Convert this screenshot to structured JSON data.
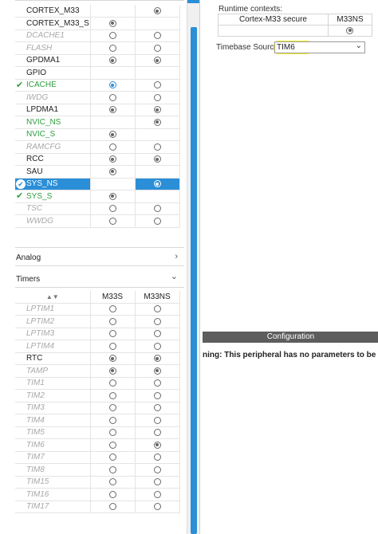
{
  "periph_rows": [
    {
      "name": "CORTEX_M33",
      "state": "normal",
      "check": "none",
      "c1": "none",
      "c2": "checked"
    },
    {
      "name": "CORTEX_M33_S",
      "state": "normal",
      "check": "none",
      "c1": "checked",
      "c2": "none"
    },
    {
      "name": "DCACHE1",
      "state": "disabled",
      "check": "none",
      "c1": "empty",
      "c2": "empty"
    },
    {
      "name": "FLASH",
      "state": "disabled",
      "check": "none",
      "c1": "empty",
      "c2": "empty"
    },
    {
      "name": "GPDMA1",
      "state": "normal",
      "check": "none",
      "c1": "checked",
      "c2": "checked"
    },
    {
      "name": "GPIO",
      "state": "normal",
      "check": "none",
      "c1": "none",
      "c2": "none"
    },
    {
      "name": "ICACHE",
      "state": "green",
      "check": "tick",
      "c1": "blue-checked",
      "c2": "empty"
    },
    {
      "name": "IWDG",
      "state": "disabled",
      "check": "none",
      "c1": "empty",
      "c2": "empty"
    },
    {
      "name": "LPDMA1",
      "state": "normal",
      "check": "none",
      "c1": "checked",
      "c2": "checked"
    },
    {
      "name": "NVIC_NS",
      "state": "green",
      "check": "none",
      "c1": "none",
      "c2": "checked"
    },
    {
      "name": "NVIC_S",
      "state": "green",
      "check": "none",
      "c1": "checked",
      "c2": "none"
    },
    {
      "name": "RAMCFG",
      "state": "disabled",
      "check": "none",
      "c1": "empty",
      "c2": "empty"
    },
    {
      "name": "RCC",
      "state": "normal",
      "check": "none",
      "c1": "checked",
      "c2": "checked"
    },
    {
      "name": "SAU",
      "state": "normal",
      "check": "none",
      "c1": "checked",
      "c2": "none"
    },
    {
      "name": "SYS_NS",
      "state": "selected",
      "check": "circle",
      "c1": "none",
      "c2": "sel"
    },
    {
      "name": "SYS_S",
      "state": "green",
      "check": "tick",
      "c1": "checked",
      "c2": "none"
    },
    {
      "name": "TSC",
      "state": "disabled",
      "check": "none",
      "c1": "empty",
      "c2": "empty"
    },
    {
      "name": "WWDG",
      "state": "disabled",
      "check": "none",
      "c1": "empty",
      "c2": "empty"
    }
  ],
  "analog_label": "Analog",
  "timers_label": "Timers",
  "timers_head": {
    "c1": "M33S",
    "c2": "M33NS"
  },
  "timer_rows": [
    {
      "name": "LPTIM1",
      "state": "disabled",
      "c1": "empty",
      "c2": "empty"
    },
    {
      "name": "LPTIM2",
      "state": "disabled",
      "c1": "empty",
      "c2": "empty"
    },
    {
      "name": "LPTIM3",
      "state": "disabled",
      "c1": "empty",
      "c2": "empty"
    },
    {
      "name": "LPTIM4",
      "state": "disabled",
      "c1": "empty",
      "c2": "empty"
    },
    {
      "name": "RTC",
      "state": "normal",
      "c1": "checked",
      "c2": "checked"
    },
    {
      "name": "TAMP",
      "state": "disabled",
      "c1": "checked",
      "c2": "checked"
    },
    {
      "name": "TIM1",
      "state": "disabled",
      "c1": "empty",
      "c2": "empty"
    },
    {
      "name": "TIM2",
      "state": "disabled",
      "c1": "empty",
      "c2": "empty"
    },
    {
      "name": "TIM3",
      "state": "disabled",
      "c1": "empty",
      "c2": "empty"
    },
    {
      "name": "TIM4",
      "state": "disabled",
      "c1": "empty",
      "c2": "empty"
    },
    {
      "name": "TIM5",
      "state": "disabled",
      "c1": "empty",
      "c2": "empty"
    },
    {
      "name": "TIM6",
      "state": "disabled",
      "c1": "empty",
      "c2": "checked"
    },
    {
      "name": "TIM7",
      "state": "disabled",
      "c1": "empty",
      "c2": "empty"
    },
    {
      "name": "TIM8",
      "state": "disabled",
      "c1": "empty",
      "c2": "empty"
    },
    {
      "name": "TIM15",
      "state": "disabled",
      "c1": "empty",
      "c2": "empty"
    },
    {
      "name": "TIM16",
      "state": "disabled",
      "c1": "empty",
      "c2": "empty"
    },
    {
      "name": "TIM17",
      "state": "disabled",
      "c1": "empty",
      "c2": "empty"
    }
  ],
  "runtime": {
    "title": "Runtime contexts:",
    "col1": "Cortex-M33 secure",
    "col2": "M33NS",
    "col1_value": "none",
    "col2_value": "checked"
  },
  "timebase": {
    "label": "Timebase Source",
    "value": "TIM6"
  },
  "configuration": {
    "header": "Configuration",
    "warning": "ning: This peripheral has no parameters to be co"
  },
  "colors": {
    "selection_blue": "#2b8fd8",
    "enabled_green": "#2e9e3f",
    "highlight_yellow": "#f5f21c",
    "config_bar": "#5d5d5d"
  }
}
